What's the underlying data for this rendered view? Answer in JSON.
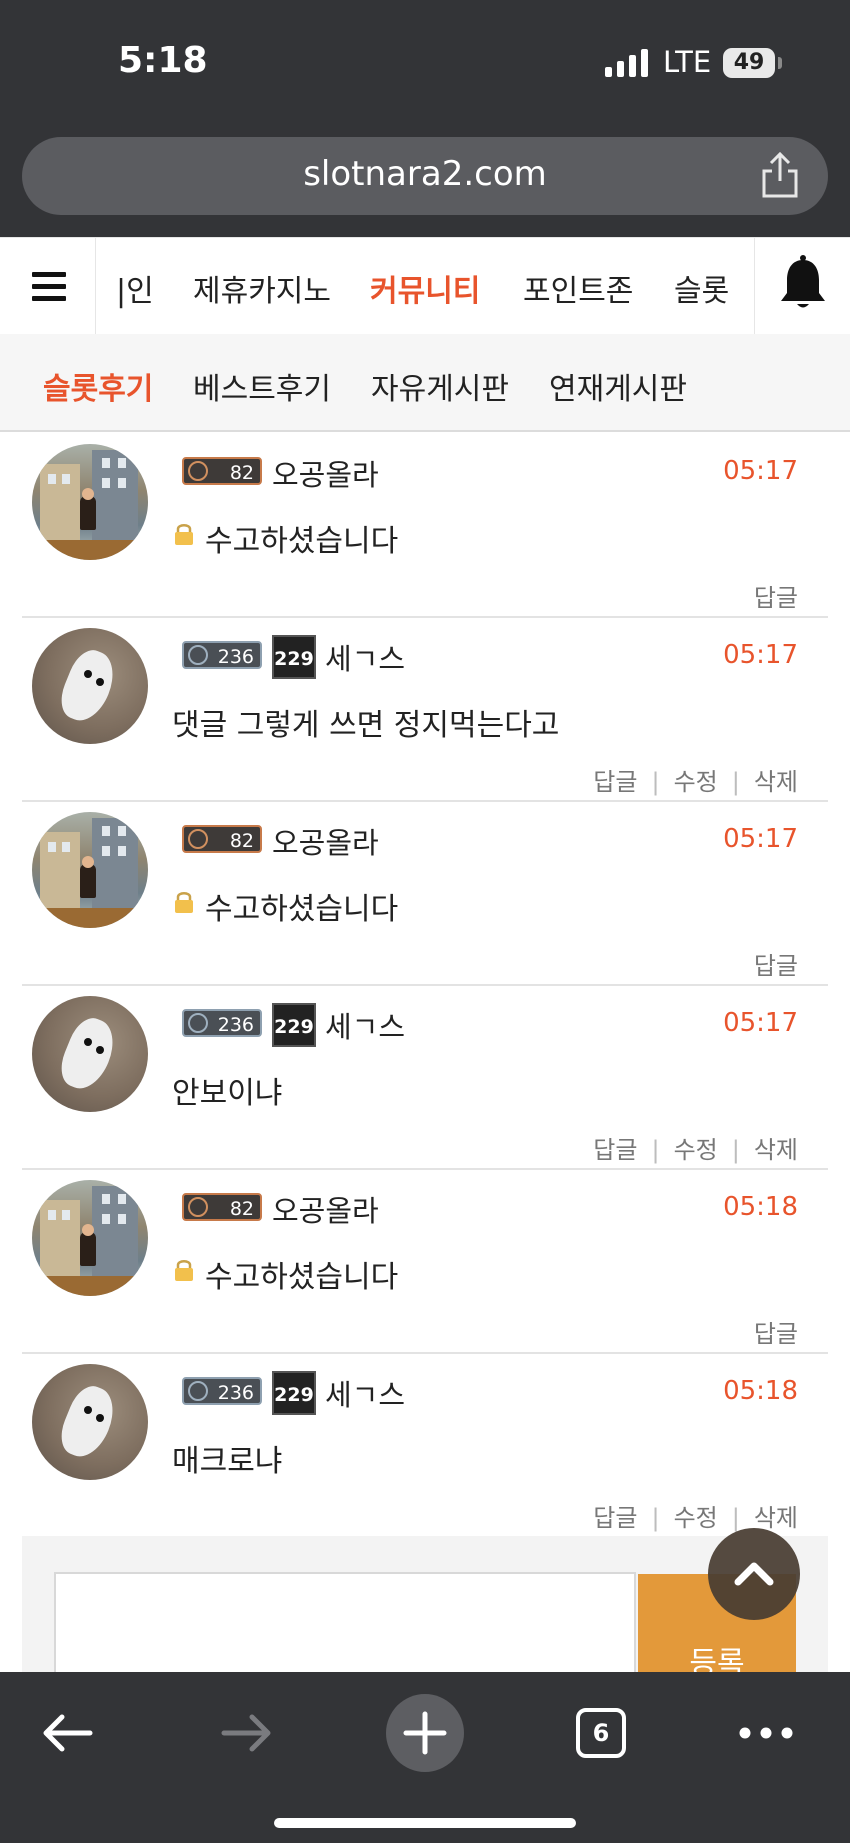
{
  "status_bar": {
    "time": "5:18",
    "network": "LTE",
    "battery": "49"
  },
  "browser": {
    "url": "slotnara2.com",
    "tab_count": "6"
  },
  "main_nav": {
    "tabs": [
      {
        "label": "|인"
      },
      {
        "label": "제휴카지노"
      },
      {
        "label": "커뮤니티",
        "active": true
      },
      {
        "label": "포인트존"
      },
      {
        "label": "슬롯"
      }
    ]
  },
  "sub_nav": {
    "tabs": [
      {
        "label": "슬롯후기",
        "active": true
      },
      {
        "label": "베스트후기"
      },
      {
        "label": "자유게시판"
      },
      {
        "label": "연재게시판"
      }
    ]
  },
  "comments": [
    {
      "level": "82",
      "nickname": "오공올라",
      "time": "05:17",
      "text": "수고하셨습니다",
      "locked": true,
      "actions": [
        "답글"
      ]
    },
    {
      "level": "236",
      "rank_badge": "229",
      "nickname": "세ㄱ스",
      "time": "05:17",
      "text": "댓글 그렇게 쓰면 정지먹는다고",
      "actions": [
        "답글",
        "수정",
        "삭제"
      ]
    },
    {
      "level": "82",
      "nickname": "오공올라",
      "time": "05:17",
      "text": "수고하셨습니다",
      "locked": true,
      "actions": [
        "답글"
      ]
    },
    {
      "level": "236",
      "rank_badge": "229",
      "nickname": "세ㄱ스",
      "time": "05:17",
      "text": "안보이냐",
      "actions": [
        "답글",
        "수정",
        "삭제"
      ]
    },
    {
      "level": "82",
      "nickname": "오공올라",
      "time": "05:18",
      "text": "수고하셨습니다",
      "locked": true,
      "actions": [
        "답글"
      ]
    },
    {
      "level": "236",
      "rank_badge": "229",
      "nickname": "세ㄱ스",
      "time": "05:18",
      "text": "매크로냐",
      "actions": [
        "답글",
        "수정",
        "삭제"
      ]
    }
  ],
  "comment_form": {
    "submit_label": "등록"
  },
  "colors": {
    "accent": "#e8542c",
    "submit": "#e3993a",
    "chrome": "#333437"
  }
}
